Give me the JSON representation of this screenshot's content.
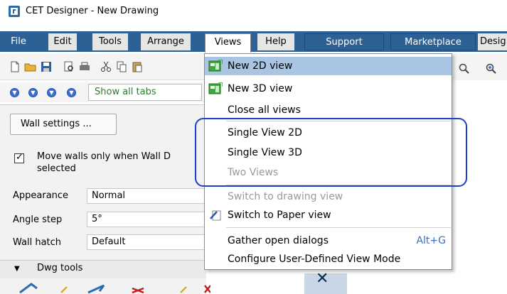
{
  "window": {
    "title": "CET Designer - New Drawing"
  },
  "menubar": {
    "file": "File",
    "edit": "Edit",
    "tools": "Tools",
    "arrange": "Arrange",
    "views": "Views",
    "help": "Help",
    "support": "Support",
    "marketplace": "Marketplace",
    "design": "Desig"
  },
  "tabs": {
    "show_all": "Show all tabs"
  },
  "panel": {
    "wall_settings": "Wall settings ...",
    "move_walls_line1": "Move walls only when Wall D",
    "move_walls_line2": "selected",
    "move_walls_checked": true,
    "appearance_label": "Appearance",
    "appearance_value": "Normal",
    "angle_label": "Angle step",
    "angle_value": "5°",
    "hatch_label": "Wall hatch",
    "hatch_value": "Default",
    "dwg_tools": "Dwg tools"
  },
  "views_menu": {
    "items": [
      {
        "label": "New 2D view",
        "icon": "new-view-icon",
        "enabled": true,
        "highlighted": true
      },
      {
        "label": "New 3D view",
        "icon": "new-view-icon",
        "enabled": true
      },
      {
        "label": "Close all views",
        "enabled": true
      },
      {
        "label": "Single View 2D",
        "enabled": true
      },
      {
        "label": "Single View 3D",
        "enabled": true
      },
      {
        "label": "Two Views",
        "enabled": false
      },
      {
        "label": "Switch to drawing view",
        "enabled": false
      },
      {
        "label": "Switch to Paper view",
        "icon": "paper-view-icon",
        "enabled": true
      },
      {
        "label": "Gather open dialogs",
        "shortcut": "Alt+G",
        "enabled": true
      },
      {
        "label": "Configure User-Defined View Mode",
        "enabled": true
      }
    ]
  },
  "colors": {
    "menubar": "#2d6095",
    "menu_hover": "#a9c5e3",
    "callout": "#1c3fd0",
    "shortcut": "#3a6fbf"
  }
}
